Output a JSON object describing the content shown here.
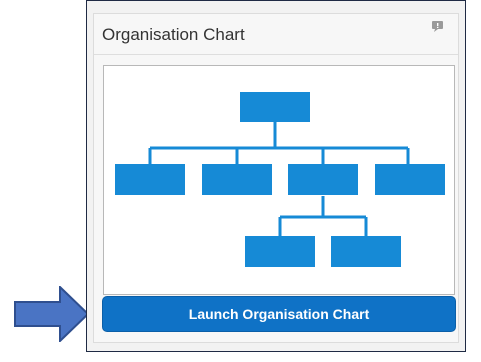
{
  "panel": {
    "title": "Organisation Chart",
    "help_icon": "speech-bubble-icon"
  },
  "preview": {
    "icon": "org-chart-diagram",
    "color": "#168ad6"
  },
  "launch_button": {
    "label": "Launch Organisation Chart",
    "color": "#0f72c6"
  },
  "annotation": {
    "icon": "right-arrow-icon",
    "color": "#4a74c4"
  }
}
